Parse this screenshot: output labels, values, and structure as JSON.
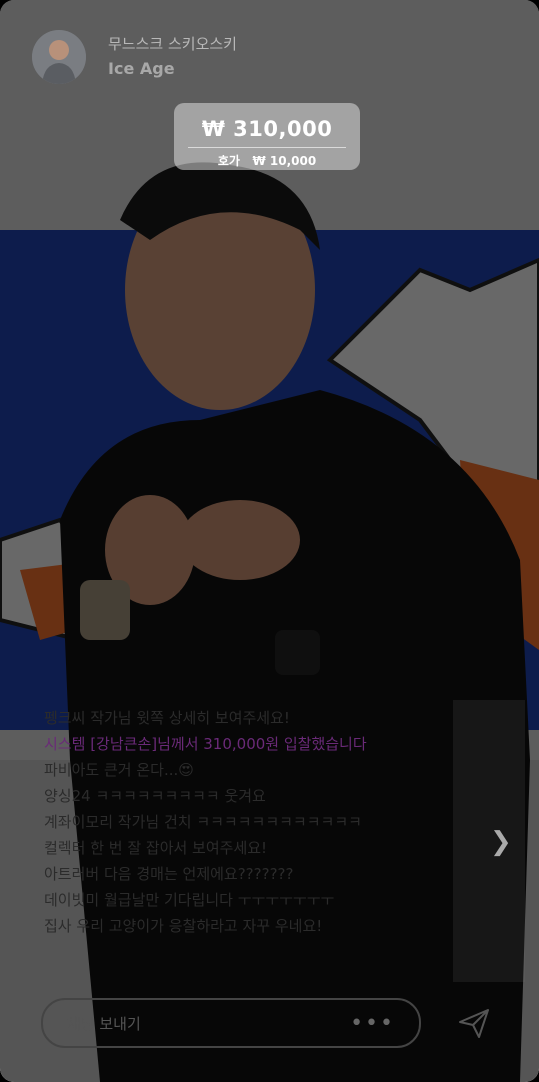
{
  "header": {
    "host_name": "무느스크 스키오스키",
    "host_subtitle": "Ice Age"
  },
  "auction": {
    "current_price": "₩ 310,000",
    "increment_label": "호가",
    "increment_value": "₩ 10,000"
  },
  "chat": {
    "messages": [
      {
        "user": "펭크씨",
        "text": "작가님 윗쪽 상세히 보여주세요!",
        "type": "user"
      },
      {
        "user": "시스템",
        "text": "[강남큰손]님께서 310,000원 입찰했습니다",
        "type": "system"
      },
      {
        "user": "파비아도",
        "text": "큰거 온다...😍",
        "type": "user"
      },
      {
        "user": "양싱24",
        "text": "ㅋㅋㅋㅋㅋㅋㅋㅋㅋ 웃겨요",
        "type": "user"
      },
      {
        "user": "계좌이모리",
        "text": "작가님 건치 ㅋㅋㅋㅋㅋㅋㅋㅋㅋㅋㅋㅋ",
        "type": "user"
      },
      {
        "user": "컬렉터",
        "text": "한 번 잘 잡아서 보여주세요!",
        "type": "user"
      },
      {
        "user": "아트러버",
        "text": "다음 경매는 언제에요???????",
        "type": "user"
      },
      {
        "user": "데이빗미",
        "text": "월급날만 기다립니다 ㅜㅜㅜㅜㅜㅜㅜ",
        "type": "user"
      },
      {
        "user": "집사",
        "text": "우리 고양이가 응찰하라고 자꾸 우네요!",
        "type": "user"
      }
    ]
  },
  "input": {
    "placeholder": "채팅 보내기",
    "more": "•••"
  },
  "icons": {
    "next": "chevron-right-icon",
    "send": "send-icon"
  },
  "colors": {
    "system_message": "#6a2a78",
    "price_box": "#dcdcdc"
  }
}
